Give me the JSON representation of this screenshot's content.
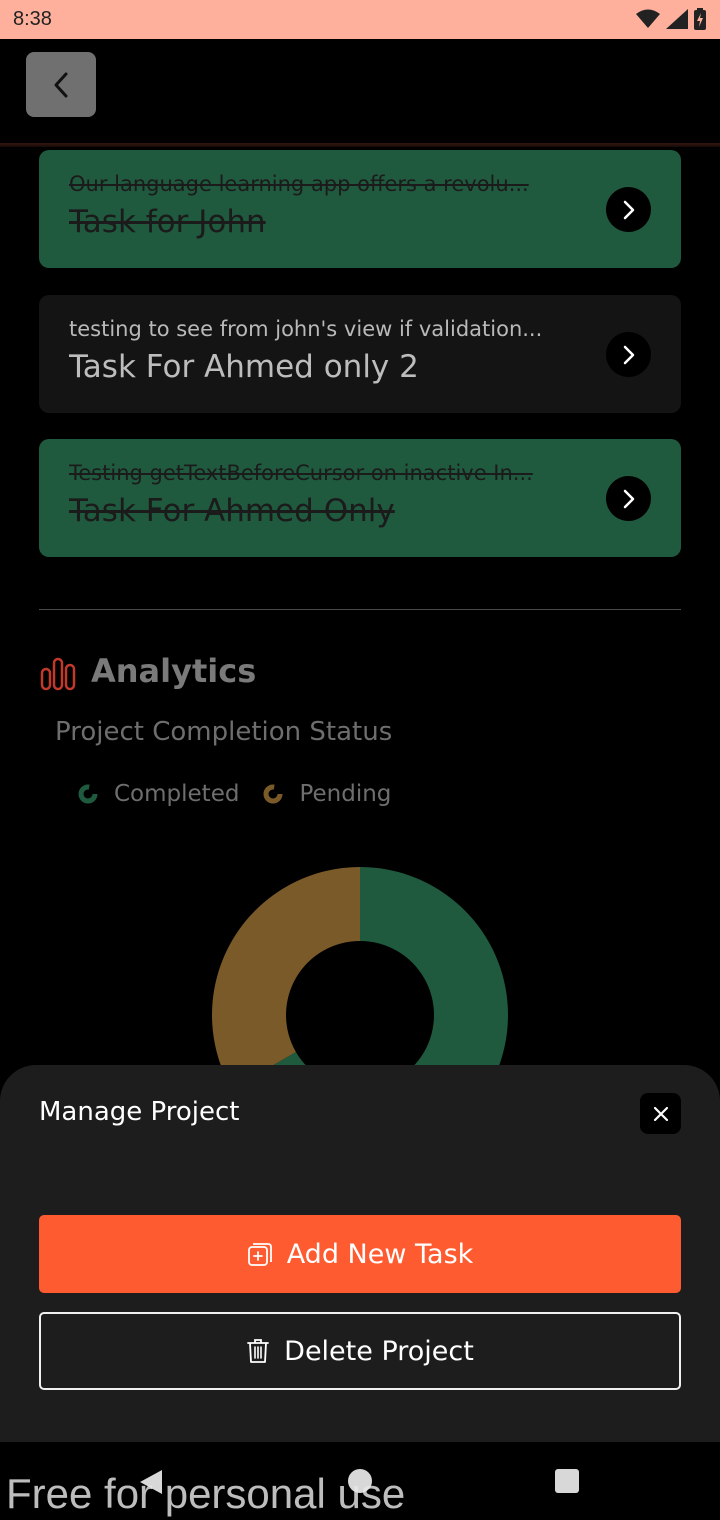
{
  "status_bar": {
    "time": "8:38"
  },
  "tasks": [
    {
      "description": "Our language learning app offers a revolu...",
      "title": "Task for John",
      "completed": true
    },
    {
      "description": "testing to see from john's view if validation...",
      "title": "Task For Ahmed only 2",
      "completed": false
    },
    {
      "description": "Testing getTextBeforeCursor on inactive In...",
      "title": "Task For Ahmed Only",
      "completed": true
    }
  ],
  "analytics": {
    "title": "Analytics",
    "chart_title": "Project Completion Status",
    "legend": [
      {
        "label": "Completed",
        "color": "#1f5a3f"
      },
      {
        "label": "Pending",
        "color": "#7a5a28"
      }
    ]
  },
  "chart_data": {
    "type": "pie",
    "title": "Project Completion Status",
    "categories": [
      "Completed",
      "Pending"
    ],
    "values": [
      2,
      1
    ],
    "legend": [
      "Completed",
      "Pending"
    ],
    "legend_placement": "top-left"
  },
  "sheet": {
    "title": "Manage Project",
    "add_label": "Add New Task",
    "delete_label": "Delete Project"
  },
  "watermark": "Free for personal use",
  "colors": {
    "accent": "#ff5b30",
    "completed": "#1f5a3f",
    "pending": "#7a5a28",
    "analytics_icon": "#c0392b"
  }
}
